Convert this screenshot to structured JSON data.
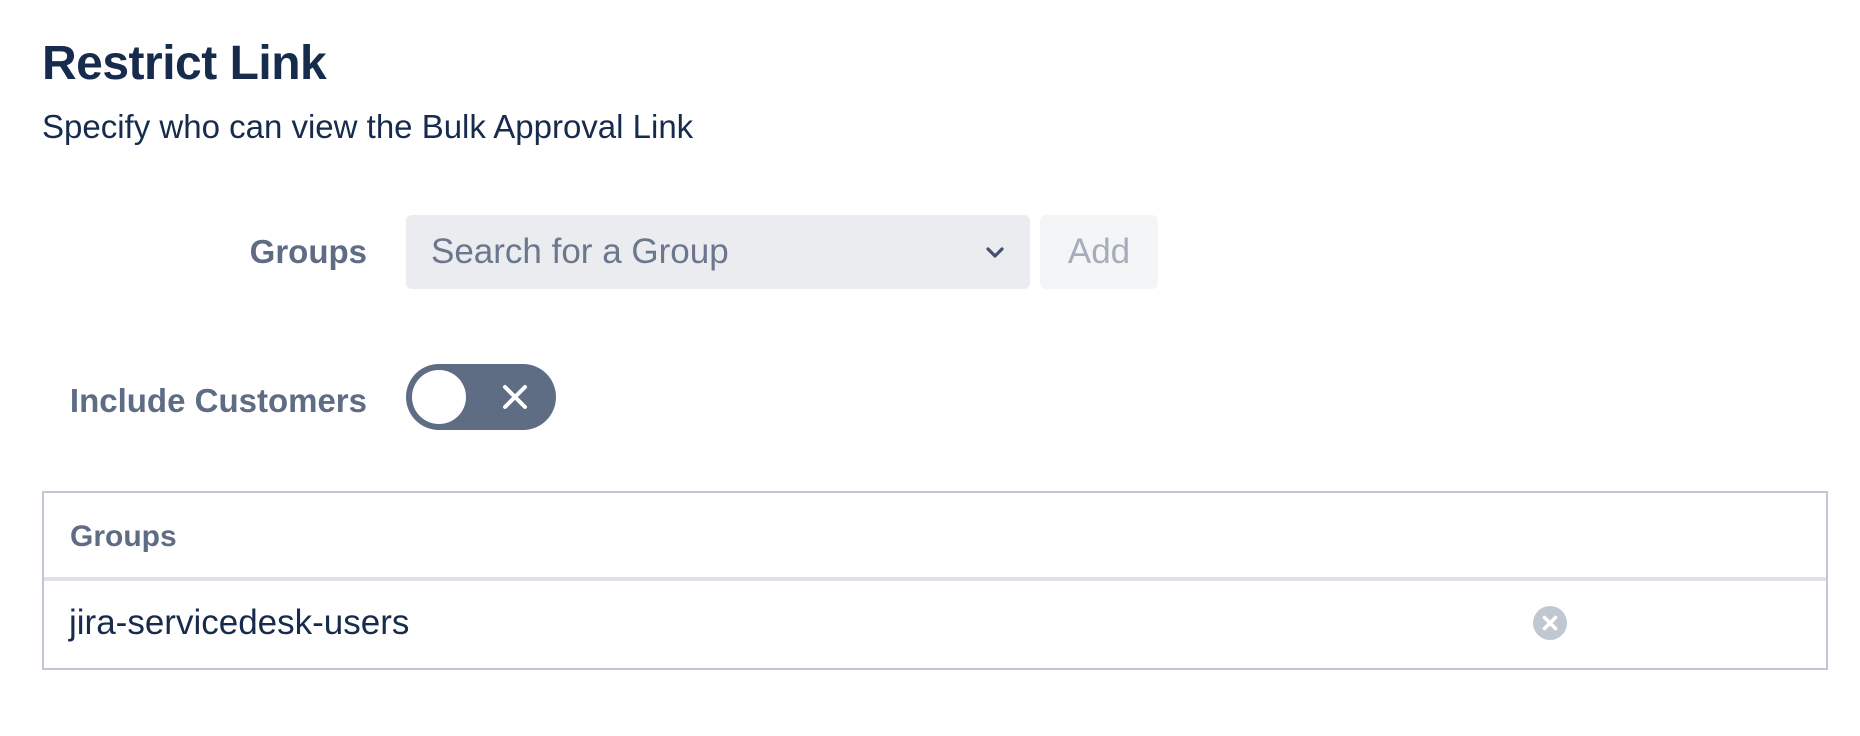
{
  "header": {
    "title": "Restrict Link",
    "subtitle": "Specify who can view the Bulk Approval Link"
  },
  "groups_field": {
    "label": "Groups",
    "placeholder": "Search for a Group",
    "add_label": "Add",
    "add_disabled": true
  },
  "include_customers": {
    "label": "Include Customers",
    "checked": false
  },
  "table": {
    "columns": [
      "Groups"
    ],
    "rows": [
      {
        "group": "jira-servicedesk-users"
      }
    ]
  },
  "colors": {
    "heading": "#172b4d",
    "label": "#5e6c84",
    "toggle_off": "#5e6c84",
    "select_bg": "#ebecf0",
    "button_disabled_bg": "#f4f5f7",
    "button_disabled_text": "#a5adba",
    "table_border": "#c1c7d0",
    "remove_icon": "#c1c7d0"
  }
}
